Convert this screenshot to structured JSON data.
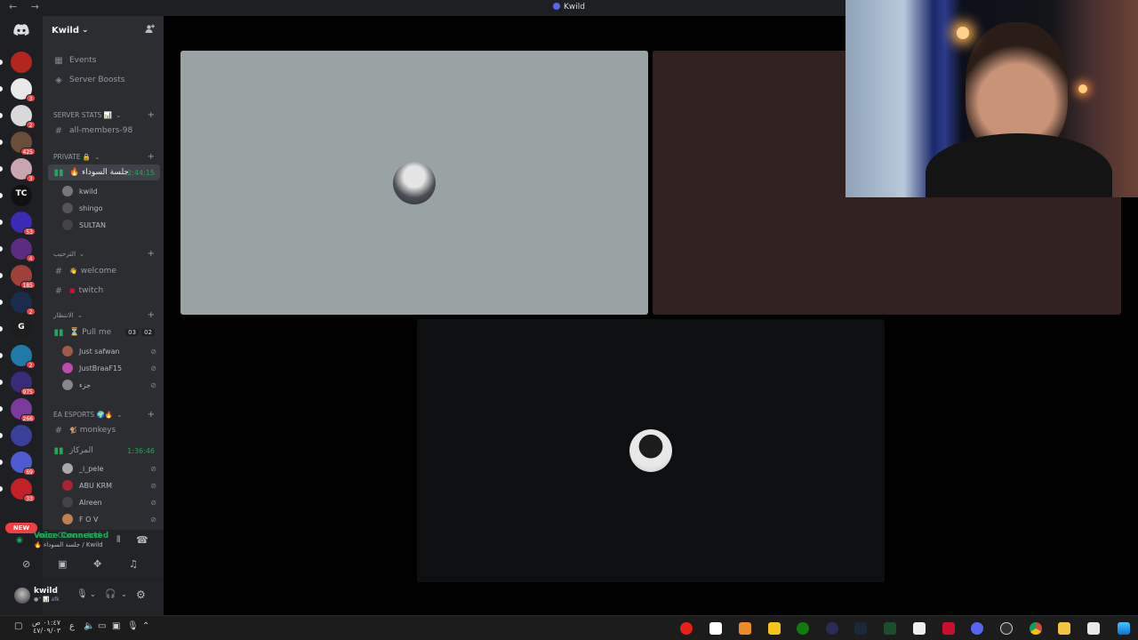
{
  "window": {
    "title": "Kwild",
    "nav_arrows": "← →"
  },
  "guild": {
    "name": "Kwild",
    "chevron": "⌄"
  },
  "servers": [
    {
      "color": "#b3261e",
      "badge": ""
    },
    {
      "color": "#e8e8e8",
      "badge": "3"
    },
    {
      "color": "#d9d9d9",
      "badge": "2"
    },
    {
      "color": "#6b4d3a",
      "badge": "425"
    },
    {
      "color": "#c9a5b0",
      "badge": "3"
    },
    {
      "color": "#111111",
      "badge": "",
      "label": "TC"
    },
    {
      "color": "#3b2bb5",
      "badge": "53"
    },
    {
      "color": "#5a2d82",
      "badge": "4"
    },
    {
      "color": "#a0403a",
      "badge": "185"
    },
    {
      "color": "#1a2c4d",
      "badge": "2"
    },
    {
      "color": "#1d1d1d",
      "badge": "",
      "label": "G"
    },
    {
      "color": "#1f7aa8",
      "badge": "2"
    },
    {
      "color": "#3a2a7a",
      "badge": "975"
    },
    {
      "color": "#7a3b9a",
      "badge": "266"
    },
    {
      "color": "#3a3f9a",
      "badge": ""
    },
    {
      "color": "#4d5bd0",
      "badge": "69"
    },
    {
      "color": "#c22127",
      "badge": "33"
    }
  ],
  "new_badge": "NEW",
  "channels": {
    "events": "Events",
    "boosts": "Server Boosts",
    "cat_stats": "SERVER STATS 📊",
    "all_members": "all-members-98",
    "cat_private": "Private 🔒",
    "voice_main": "🔥 جلسة السوداء",
    "voice_main_timer": "2:44:15",
    "users_main": [
      {
        "name": "kwild",
        "color": "#777"
      },
      {
        "name": "shingo",
        "color": "#555"
      },
      {
        "name": "SULTAN",
        "color": "#444"
      }
    ],
    "cat_welcome": "الترحيب",
    "welcome": "welcome",
    "twitch": "twitch",
    "cat_wait": "الانتظار",
    "pull_me": "⏳ Pull me",
    "pull_cnt1": "03",
    "pull_cnt2": "02",
    "users_pull": [
      {
        "name": "Just safwan",
        "color": "#a05a4a"
      },
      {
        "name": "JustBraaF15",
        "color": "#c04ab0"
      },
      {
        "name": "جزء",
        "color": "#888"
      }
    ],
    "cat_ea": "EA ESPORTS 🌍🔥",
    "monkeys": "monkeys",
    "voice_center": "المركاز",
    "voice_center_timer": "1:36:46",
    "users_center": [
      {
        "name": "_i_pele",
        "color": "#aaa"
      },
      {
        "name": "ABU KRM",
        "color": "#a23"
      },
      {
        "name": "Alreen",
        "color": "#444"
      },
      {
        "name": "F O V",
        "color": "#c08050"
      }
    ]
  },
  "voice": {
    "status": "Voice Connected",
    "location": "🔥 جلسة السوداء / Kwild"
  },
  "user": {
    "name": "kwild",
    "status": "●° 📊 afk"
  },
  "taskbar": {
    "time": "٠١:٤٧ ص",
    "date": "٤٧/٠٩/٠٣",
    "lang": "ع"
  }
}
